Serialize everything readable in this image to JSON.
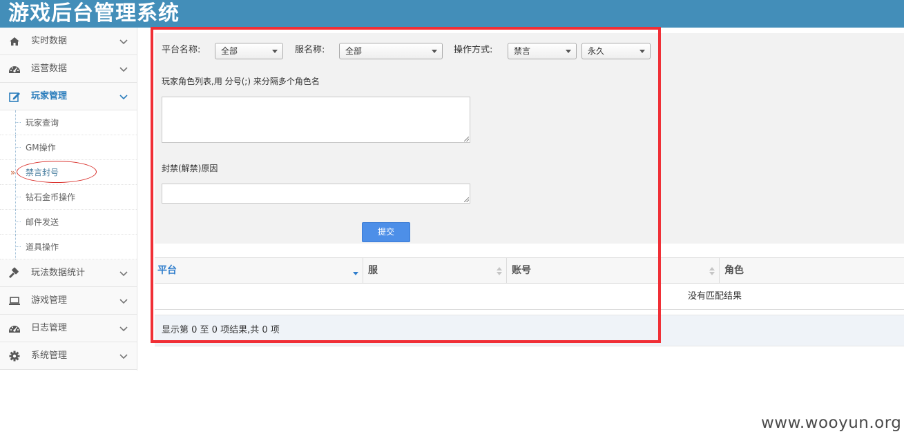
{
  "header": {
    "title": "游戏后台管理系统"
  },
  "sidebar": {
    "items": [
      {
        "label": "实时数据",
        "icon": "home-icon"
      },
      {
        "label": "运营数据",
        "icon": "dashboard-icon"
      },
      {
        "label": "玩家管理",
        "icon": "edit-icon",
        "active": true
      },
      {
        "label": "玩法数据统计",
        "icon": "gavel-icon"
      },
      {
        "label": "游戏管理",
        "icon": "laptop-icon"
      },
      {
        "label": "日志管理",
        "icon": "dashboard-icon"
      },
      {
        "label": "系统管理",
        "icon": "gear-icon"
      }
    ],
    "submenu": [
      {
        "label": "玩家查询"
      },
      {
        "label": "GM操作"
      },
      {
        "label": "禁言封号",
        "current": true
      },
      {
        "label": "钻石金币操作"
      },
      {
        "label": "邮件发送"
      },
      {
        "label": "道具操作"
      }
    ],
    "current_marker": "»"
  },
  "filters": {
    "platform_label": "平台名称:",
    "platform_value": "全部",
    "server_label": "服名称:",
    "server_value": "全部",
    "operation_label": "操作方式:",
    "operation_value": "禁言",
    "duration_value": "永久"
  },
  "form": {
    "roles_label": "玩家角色列表,用 分号(;) 来分隔多个角色名",
    "reason_label": "封禁(解禁)原因",
    "submit_label": "提交"
  },
  "table": {
    "columns": [
      "平台",
      "服",
      "账号",
      "角色"
    ],
    "empty_text": "没有匹配结果",
    "summary": "显示第 0 至 0 项结果,共 0 项"
  },
  "watermark": "www.wooyun.org",
  "colors": {
    "header_bg": "#438eb9",
    "accent": "#2b7dbc",
    "highlight_border": "#f02f36",
    "submit_bg": "#4d8fe8"
  }
}
